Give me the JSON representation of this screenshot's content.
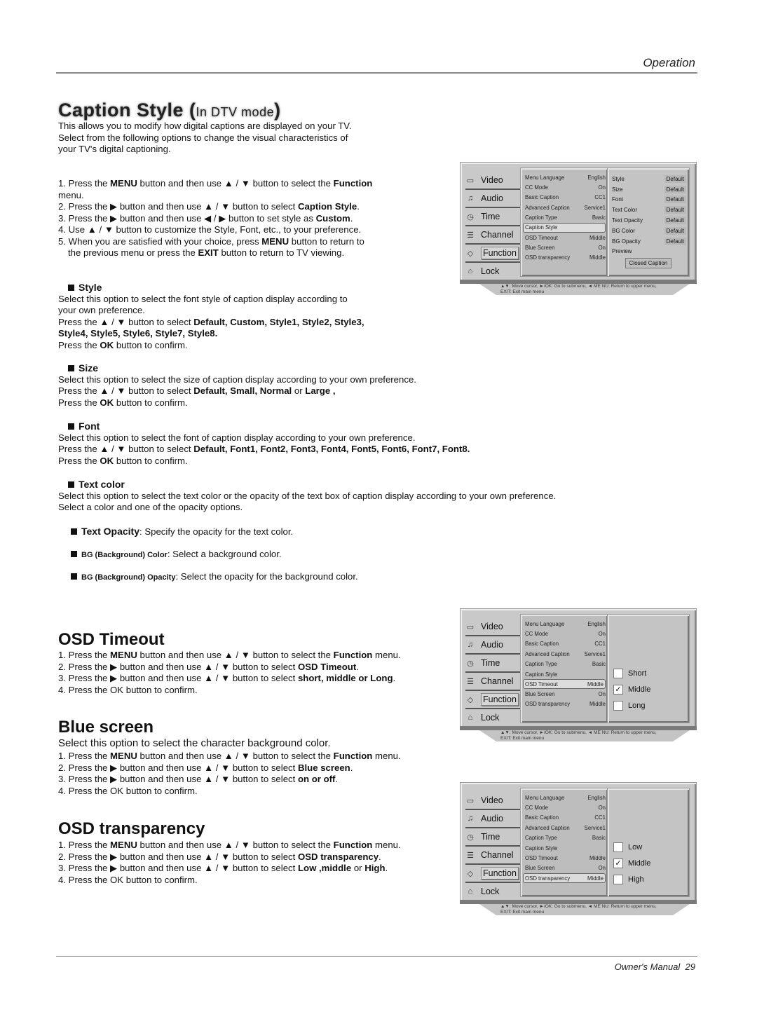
{
  "header": {
    "section": "Operation"
  },
  "footer": {
    "label": "Owner's Manual",
    "page": "29"
  },
  "caption_style": {
    "title": "Caption Style",
    "title_sub": "In DTV mode",
    "intro": [
      "This allows you to modify how digital captions are displayed on your TV.",
      "Select from the following options to change the visual characteristics of",
      "your TV's digital captioning."
    ],
    "steps": [
      {
        "pre": "1. Press the ",
        "b1": "MENU",
        "mid": " button and then use ▲ / ▼ button to select the ",
        "b2": "Function",
        "post": ""
      },
      {
        "pre": "menu.",
        "b1": "",
        "mid": "",
        "b2": "",
        "post": ""
      },
      {
        "pre": "2. Press the ▶ button and then use ▲ / ▼ button to select ",
        "b1": "Caption Style",
        "mid": ".",
        "b2": "",
        "post": ""
      },
      {
        "pre": "3. Press the ▶ button and then use ◀ / ▶ button to set style as ",
        "b1": "Custom",
        "mid": ".",
        "b2": "",
        "post": ""
      },
      {
        "pre": "4. Use ▲ / ▼ button to customize the Style, Font, etc., to your preference.",
        "b1": "",
        "mid": "",
        "b2": "",
        "post": ""
      },
      {
        "pre": "5. When you are satisfied with your choice,  press ",
        "b1": "MENU",
        "mid": " button to return to",
        "b2": "",
        "post": ""
      },
      {
        "pre": "the previous menu or press the ",
        "b1": "EXIT",
        "mid": " button to return to TV viewing.",
        "b2": "",
        "post": ""
      }
    ],
    "options": {
      "style": {
        "title": "Style",
        "l1": "Select this option to select the font style of caption display according to",
        "l2": "your own preference.",
        "l3_pre": "Press the ▲ / ▼  button to select ",
        "l3_b": "Default, Custom, Style1, Style2, Style3,",
        "l4_b": "Style4, Style5, Style6, Style7, Style8.",
        "l5_pre": "Press the ",
        "l5_b": "OK",
        "l5_post": " button to confirm."
      },
      "size": {
        "title": "Size",
        "l1": "Select this option to select the size of caption display according to your own preference.",
        "l2_pre": "Press the ▲ / ▼  button to select ",
        "l2_b": "Default, Small, Normal",
        "l2_mid": " or ",
        "l2_b2": "Large ,",
        "l3_pre": "Press the ",
        "l3_b": "OK",
        "l3_post": " button to confirm."
      },
      "font": {
        "title": "Font",
        "l1": "Select this option to select the font of caption display according to your own preference.",
        "l2_pre": "Press the ▲ / ▼  button to select ",
        "l2_b": "Default, Font1,  Font2,  Font3, Font4, Font5, Font6, Font7, Font8.",
        "l3_pre": "Press the ",
        "l3_b": "OK",
        "l3_post": " button to confirm."
      },
      "text_color": {
        "title": "Text color",
        "l1": "Select this option to select the text color or the opacity of the text box of caption display according to your own preference.",
        "l2": "Select a color and one of the opacity options."
      },
      "text_opacity": {
        "title": "Text Opacity",
        "desc": ": Specify the opacity for the text color."
      },
      "bg_color": {
        "title": "BG (Background) Color",
        "desc": ": Select a background color."
      },
      "bg_opacity": {
        "title": "BG (Background) Opacity",
        "desc": ": Select the opacity for the background color."
      }
    }
  },
  "osd_timeout": {
    "title": "OSD Timeout",
    "steps": [
      {
        "pre": "1. Press the ",
        "b1": "MENU",
        "mid": " button and then use ▲ / ▼ button to select the ",
        "b2": "Function",
        "post": " menu."
      },
      {
        "pre": "2. Press the ▶ button and then use ▲ / ▼ button to select ",
        "b1": "OSD Timeout",
        "mid": ".",
        "b2": "",
        "post": ""
      },
      {
        "pre": "3. Press the ▶ button and then use ▲ / ▼ button to select ",
        "b1": "short, middle or Long",
        "mid": ".",
        "b2": "",
        "post": ""
      },
      {
        "pre": "4. Press the OK button to confirm.",
        "b1": "",
        "mid": "",
        "b2": "",
        "post": ""
      }
    ]
  },
  "blue_screen": {
    "title": "Blue screen",
    "intro": "Select this option to select the character background color.",
    "steps": [
      {
        "pre": "1. Press the ",
        "b1": "MENU",
        "mid": " button and then use ▲ / ▼ button to select the ",
        "b2": "Function",
        "post": " menu."
      },
      {
        "pre": "2. Press the ▶ button and then use ▲ / ▼ button to select ",
        "b1": "Blue screen",
        "mid": ".",
        "b2": "",
        "post": ""
      },
      {
        "pre": "3. Press the ▶ button and then use ▲ / ▼ button to select ",
        "b1": "on or off",
        "mid": ".",
        "b2": "",
        "post": ""
      },
      {
        "pre": "4. Press the OK button to confirm.",
        "b1": "",
        "mid": "",
        "b2": "",
        "post": ""
      }
    ]
  },
  "osd_transparency": {
    "title": "OSD transparency",
    "steps": [
      {
        "pre": "1. Press the ",
        "b1": "MENU",
        "mid": " button and then use ▲ / ▼ button to select the ",
        "b2": "Function",
        "post": " menu."
      },
      {
        "pre": "2. Press the ▶ button and then use ▲ / ▼ button to select ",
        "b1": "OSD transparency",
        "mid": ".",
        "b2": "",
        "post": ""
      },
      {
        "pre": "3. Press the ▶ button and then use ▲ / ▼ button to select ",
        "b1": "Low ,middle",
        "mid": " or ",
        "b2": "High",
        "post": "."
      },
      {
        "pre": "4. Press the OK button to confirm.",
        "b1": "",
        "mid": "",
        "b2": "",
        "post": ""
      }
    ]
  },
  "osd_menu": {
    "categories": [
      {
        "label": "Video",
        "icon": "tv-icon",
        "glyph": "▭"
      },
      {
        "label": "Audio",
        "icon": "music-note-icon",
        "glyph": "♫"
      },
      {
        "label": "Time",
        "icon": "clock-icon",
        "glyph": "◷"
      },
      {
        "label": "Channel",
        "icon": "channel-list-icon",
        "glyph": "☰"
      },
      {
        "label": "Function",
        "icon": "tag-icon",
        "glyph": "◇"
      },
      {
        "label": "Lock",
        "icon": "lock-icon",
        "glyph": "⌂"
      }
    ],
    "items": [
      {
        "label": "Menu Language",
        "value": "English"
      },
      {
        "label": "CC Mode",
        "value": "On"
      },
      {
        "label": "Basic Caption",
        "value": "CC1"
      },
      {
        "label": "Advanced Caption",
        "value": "Service1"
      },
      {
        "label": "Caption Type",
        "value": "Basic"
      },
      {
        "label": "Caption Style",
        "value": ""
      },
      {
        "label": "OSD Timeout",
        "value": "Middle"
      },
      {
        "label": "Blue Screen",
        "value": "On"
      },
      {
        "label": "OSD transparency",
        "value": "Middle"
      }
    ],
    "help_line1": "▲▼: Move cursor,  ►/OK: Go to submenu,  ◄ ME NU: Return to upper menu,",
    "help_line2": "EXIT: Exit main menu",
    "caption_style_props": [
      {
        "label": "Style",
        "value": "Default"
      },
      {
        "label": "Size",
        "value": "Default"
      },
      {
        "label": "Font",
        "value": "Default"
      },
      {
        "label": "Text Color",
        "value": "Default"
      },
      {
        "label": "Text Opacity",
        "value": "Default"
      },
      {
        "label": "BG Color",
        "value": "Default"
      },
      {
        "label": "BG Opacity",
        "value": "Default"
      },
      {
        "label": "Preview",
        "value": ""
      }
    ],
    "preview_button": "Closed Caption",
    "timeout_options": [
      {
        "label": "Short",
        "checked": false
      },
      {
        "label": "Middle",
        "checked": true
      },
      {
        "label": "Long",
        "checked": false
      }
    ],
    "transparency_options": [
      {
        "label": "Low",
        "checked": false
      },
      {
        "label": "Middle",
        "checked": true
      },
      {
        "label": "High",
        "checked": false
      }
    ],
    "check_glyph": "✓"
  }
}
